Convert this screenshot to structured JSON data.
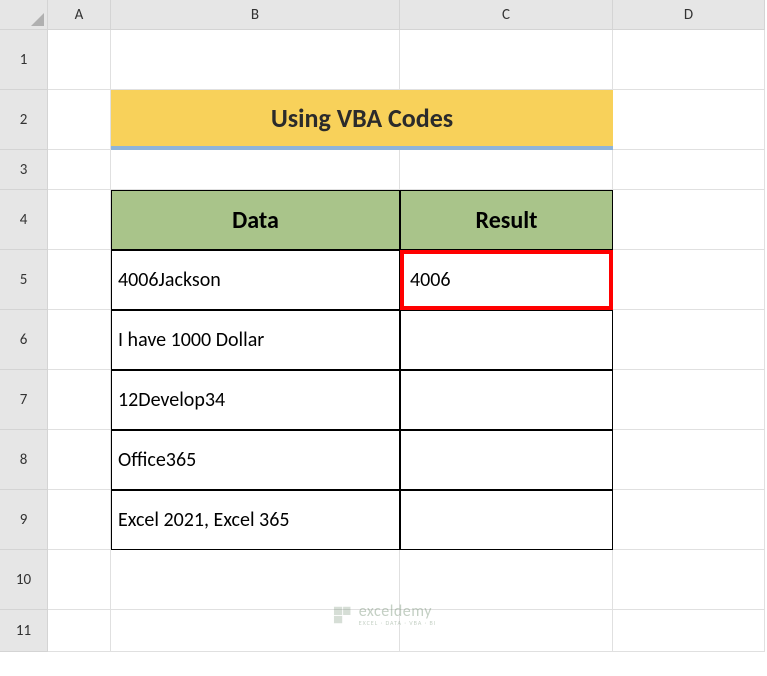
{
  "columns": [
    "A",
    "B",
    "C",
    "D"
  ],
  "rows": [
    "1",
    "2",
    "3",
    "4",
    "5",
    "6",
    "7",
    "8",
    "9",
    "10",
    "11"
  ],
  "title": "Using VBA Codes",
  "headers": {
    "data": "Data",
    "result": "Result"
  },
  "table": [
    {
      "data": "4006Jackson",
      "result": "4006"
    },
    {
      "data": "I have 1000 Dollar",
      "result": ""
    },
    {
      "data": "12Develop34",
      "result": ""
    },
    {
      "data": "Office365",
      "result": ""
    },
    {
      "data": "Excel 2021, Excel 365",
      "result": ""
    }
  ],
  "watermark": {
    "main": "exceldemy",
    "sub": "EXCEL · DATA · VBA · BI"
  }
}
